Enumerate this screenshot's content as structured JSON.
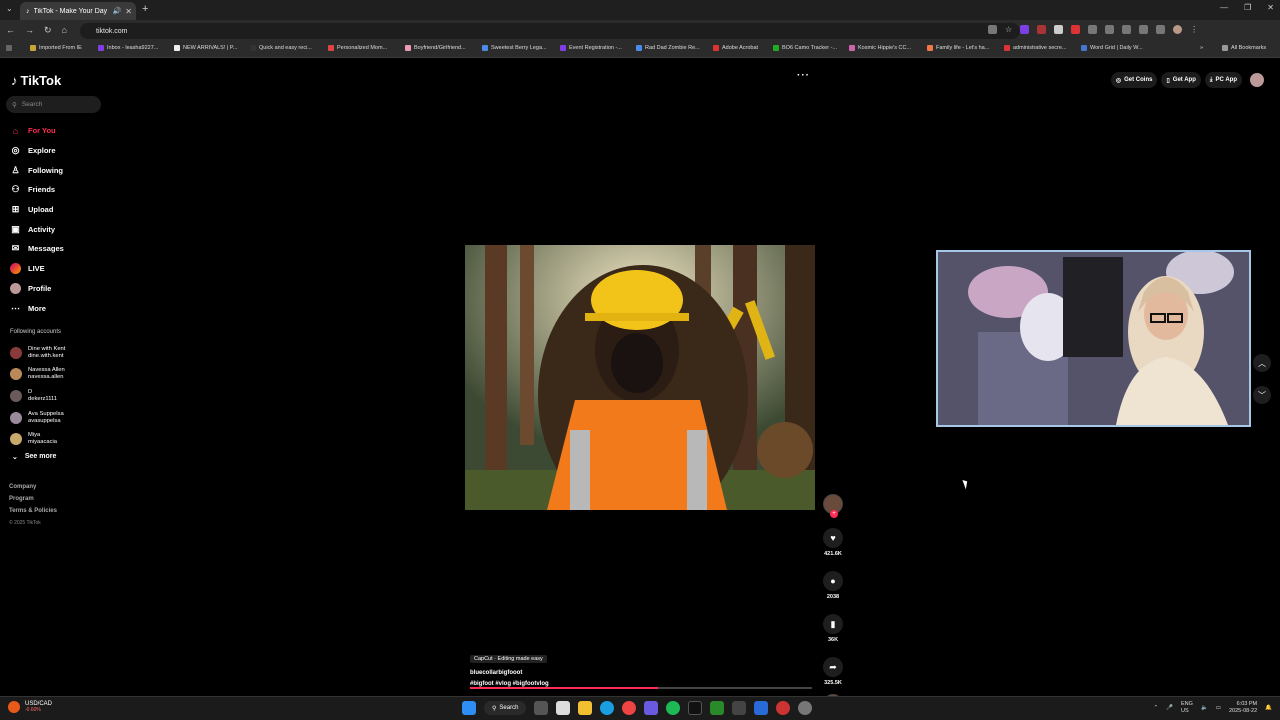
{
  "browser": {
    "tab_title": "TikTok - Make Your Day",
    "url": "tiktok.com",
    "bookmarks": [
      "Imported From IE",
      "Inbox - leasha9227...",
      "NEW ARRIVALS! | P...",
      "Quick and easy reci...",
      "Personalized Mom...",
      "Boyfriend/Girlfriend...",
      "Sweetest Berry Lega...",
      "Event Registration -...",
      "Rad Dad Zombie Re...",
      "Adobe Acrobat",
      "BO6 Camo Tracker -...",
      "Kosmic Hippie's CC...",
      "Family life - Let's ha...",
      "administrative secre...",
      "Word Grid | Daily W..."
    ],
    "all_bookmarks": "All Bookmarks"
  },
  "tiktok": {
    "logo": "TikTok",
    "search_placeholder": "Search",
    "nav": [
      {
        "label": "For You",
        "icon": "home-icon"
      },
      {
        "label": "Explore",
        "icon": "compass-icon"
      },
      {
        "label": "Following",
        "icon": "user-follow-icon"
      },
      {
        "label": "Friends",
        "icon": "friends-icon"
      },
      {
        "label": "Upload",
        "icon": "upload-icon"
      },
      {
        "label": "Activity",
        "icon": "activity-icon"
      },
      {
        "label": "Messages",
        "icon": "messages-icon"
      },
      {
        "label": "LIVE",
        "icon": "live-icon"
      },
      {
        "label": "Profile",
        "icon": "profile-icon"
      },
      {
        "label": "More",
        "icon": "more-icon"
      }
    ],
    "following_title": "Following accounts",
    "following": [
      {
        "name": "Dine with Kent",
        "handle": "dine.with.kent"
      },
      {
        "name": "Navessa Allen",
        "handle": "navessa.allen"
      },
      {
        "name": "D",
        "handle": "dekerz1111"
      },
      {
        "name": "Ava Suppelsa",
        "handle": "avasuppelsa"
      },
      {
        "name": "Miya",
        "handle": "miyaacacia"
      }
    ],
    "see_more": "See more",
    "footer": [
      "Company",
      "Program",
      "Terms & Policies"
    ],
    "copyright": "© 2025 TikTok",
    "top_buttons": [
      "Get Coins",
      "Get App",
      "PC App"
    ],
    "video": {
      "capcut": "CapCut · Editing made easy",
      "author": "bluecollarbigfooot",
      "tags": "#bigfoot  #vlog  #bigfootvlog",
      "progress": 0.55,
      "likes": "421.6K",
      "comments": "2038",
      "saves": "36K",
      "shares": "325.5K"
    }
  },
  "taskbar": {
    "stock_name": "USD/CAD",
    "stock_change": "-0.60%",
    "search_label": "Search",
    "lang1": "ENG",
    "lang2": "US",
    "time": "6:03 PM",
    "date": "2025-08-22"
  },
  "colors": {
    "accent": "#fe2c55",
    "webcam_border": "#a7c7e7"
  }
}
